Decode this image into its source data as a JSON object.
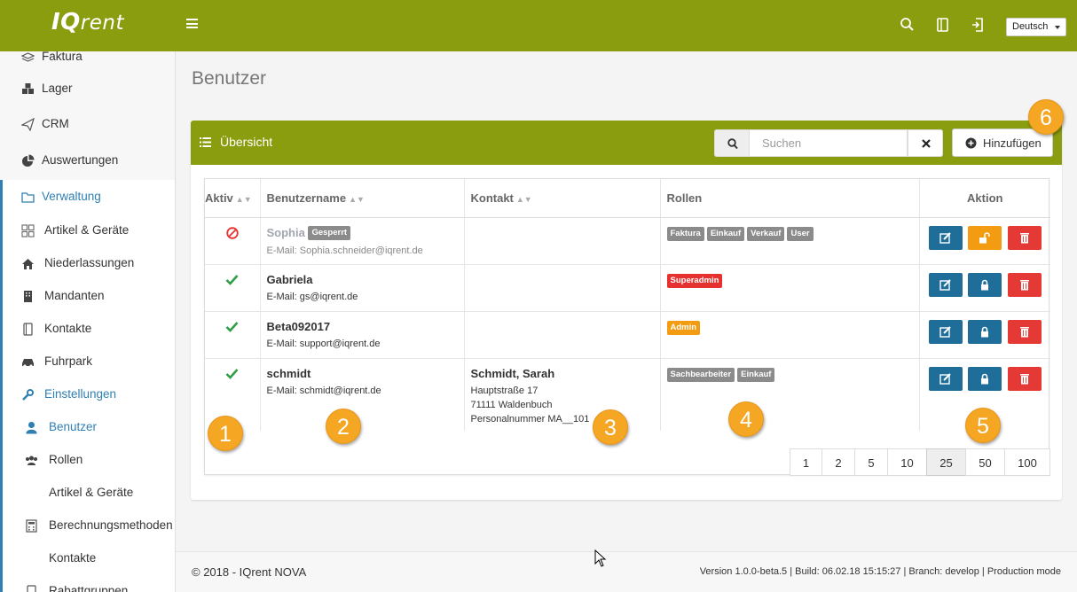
{
  "header": {
    "brand_bold": "IQ",
    "brand_light": "rent",
    "language": "Deutsch"
  },
  "sidebar": {
    "items": [
      {
        "label": "Faktura",
        "icon": "layers-icon"
      },
      {
        "label": "Lager",
        "icon": "cubes-icon"
      },
      {
        "label": "CRM",
        "icon": "paper-plane-icon"
      },
      {
        "label": "Auswertungen",
        "icon": "pie-chart-icon"
      },
      {
        "label": "Verwaltung",
        "icon": "folder-icon"
      },
      {
        "label": "Artikel & Geräte",
        "icon": "grid-icon"
      },
      {
        "label": "Niederlassungen",
        "icon": "home-icon"
      },
      {
        "label": "Mandanten",
        "icon": "building-icon"
      },
      {
        "label": "Kontakte",
        "icon": "address-book-icon"
      },
      {
        "label": "Fuhrpark",
        "icon": "car-icon"
      },
      {
        "label": "Einstellungen",
        "icon": "wrench-icon"
      },
      {
        "label": "Benutzer",
        "icon": "user-icon"
      },
      {
        "label": "Rollen",
        "icon": "users-icon"
      },
      {
        "label": "Artikel & Geräte",
        "icon": ""
      },
      {
        "label": "Berechnungsmethoden",
        "icon": "calculator-icon"
      },
      {
        "label": "Kontakte",
        "icon": ""
      },
      {
        "label": "Rabattgruppen",
        "icon": "address-book-icon"
      }
    ]
  },
  "page": {
    "title": "Benutzer"
  },
  "panel": {
    "title": "Übersicht",
    "search_placeholder": "Suchen",
    "add_label": "Hinzufügen"
  },
  "table": {
    "columns": [
      "Aktiv",
      "Benutzername",
      "Kontakt",
      "Rollen",
      "Aktion"
    ],
    "rows": [
      {
        "active": false,
        "username": "Sophia",
        "status_badge": "Gesperrt",
        "email": "E-Mail: Sophia.schneider@iqrent.de",
        "contact": null,
        "roles": [
          "Faktura",
          "Einkauf",
          "Verkauf",
          "User"
        ]
      },
      {
        "active": true,
        "username": "Gabriela",
        "email": "E-Mail: gs@iqrent.de",
        "contact": null,
        "roles": [
          "Superadmin"
        ]
      },
      {
        "active": true,
        "username": "Beta092017",
        "email": "E-Mail: support@iqrent.de",
        "contact": null,
        "roles": [
          "Admin"
        ]
      },
      {
        "active": true,
        "username": "schmidt",
        "email": "E-Mail: schmidt@iqrent.de",
        "contact": {
          "name": "Schmidt, Sarah",
          "street": "Hauptstraße 17",
          "city": "71111 Waldenbuch",
          "staff_no": "Personalnummer MA__101"
        },
        "roles": [
          "Sachbearbeiter",
          "Einkauf"
        ]
      }
    ]
  },
  "pagination": {
    "sizes": [
      "1",
      "2",
      "5",
      "10",
      "25",
      "50",
      "100"
    ],
    "selected": "25"
  },
  "footer": {
    "copyright": "© 2018 - IQrent NOVA",
    "version": "Version 1.0.0-beta.5 | Build: 06.02.18 15:15:27 | Branch: develop | Production mode"
  },
  "callouts": [
    "1",
    "2",
    "3",
    "4",
    "5",
    "6"
  ],
  "colors": {
    "brand": "#8a9d0e",
    "accent_blue": "#2f7fb3",
    "danger": "#e5322e",
    "warning": "#f39c12",
    "callout": "#f5a623"
  }
}
